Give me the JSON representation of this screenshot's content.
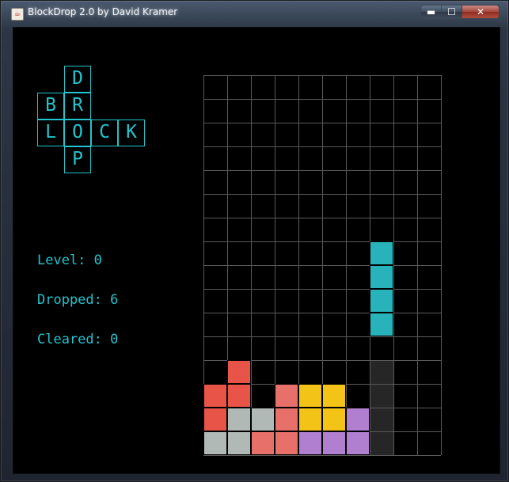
{
  "window": {
    "title": "BlockDrop 2.0 by David Kramer",
    "controls": {
      "minimize": "▬",
      "maximize": "☐",
      "close": "✕"
    },
    "icon": "java-cup-icon"
  },
  "logo": {
    "letters": [
      {
        "ch": "D",
        "col": 1,
        "row": 0
      },
      {
        "ch": "B",
        "col": 0,
        "row": 1
      },
      {
        "ch": "R",
        "col": 1,
        "row": 1
      },
      {
        "ch": "L",
        "col": 0,
        "row": 2
      },
      {
        "ch": "O",
        "col": 1,
        "row": 2
      },
      {
        "ch": "C",
        "col": 2,
        "row": 2
      },
      {
        "ch": "K",
        "col": 3,
        "row": 2
      },
      {
        "ch": "P",
        "col": 1,
        "row": 3
      }
    ]
  },
  "stats": {
    "level": "Level: 0",
    "dropped": "Dropped: 6",
    "cleared": "Cleared: 0"
  },
  "board": {
    "cols": 10,
    "rows": 16,
    "colors": {
      "red": "#e85548",
      "salmon": "#e8706a",
      "yellow": "#f3c318",
      "gray": "#b1b9b7",
      "purple": "#b07fcf",
      "cyan": "#27b3b9",
      "ghost": "#262626",
      "grid": "#5a5a5a"
    },
    "falling_piece": {
      "color": "cyan",
      "cells": [
        [
          7,
          7
        ],
        [
          7,
          8
        ],
        [
          7,
          9
        ],
        [
          7,
          10
        ]
      ]
    },
    "ghost_cells": [
      [
        7,
        12
      ],
      [
        7,
        13
      ],
      [
        7,
        14
      ],
      [
        7,
        15
      ]
    ],
    "placed_cells": [
      {
        "c": 1,
        "r": 12,
        "color": "red"
      },
      {
        "c": 0,
        "r": 13,
        "color": "red"
      },
      {
        "c": 1,
        "r": 13,
        "color": "red"
      },
      {
        "c": 3,
        "r": 13,
        "color": "salmon"
      },
      {
        "c": 4,
        "r": 13,
        "color": "yellow"
      },
      {
        "c": 5,
        "r": 13,
        "color": "yellow"
      },
      {
        "c": 0,
        "r": 14,
        "color": "red"
      },
      {
        "c": 1,
        "r": 14,
        "color": "gray"
      },
      {
        "c": 2,
        "r": 14,
        "color": "gray"
      },
      {
        "c": 3,
        "r": 14,
        "color": "salmon"
      },
      {
        "c": 4,
        "r": 14,
        "color": "yellow"
      },
      {
        "c": 5,
        "r": 14,
        "color": "yellow"
      },
      {
        "c": 6,
        "r": 14,
        "color": "purple"
      },
      {
        "c": 0,
        "r": 15,
        "color": "gray"
      },
      {
        "c": 1,
        "r": 15,
        "color": "gray"
      },
      {
        "c": 2,
        "r": 15,
        "color": "salmon"
      },
      {
        "c": 3,
        "r": 15,
        "color": "salmon"
      },
      {
        "c": 4,
        "r": 15,
        "color": "purple"
      },
      {
        "c": 5,
        "r": 15,
        "color": "purple"
      },
      {
        "c": 6,
        "r": 15,
        "color": "purple"
      }
    ]
  }
}
